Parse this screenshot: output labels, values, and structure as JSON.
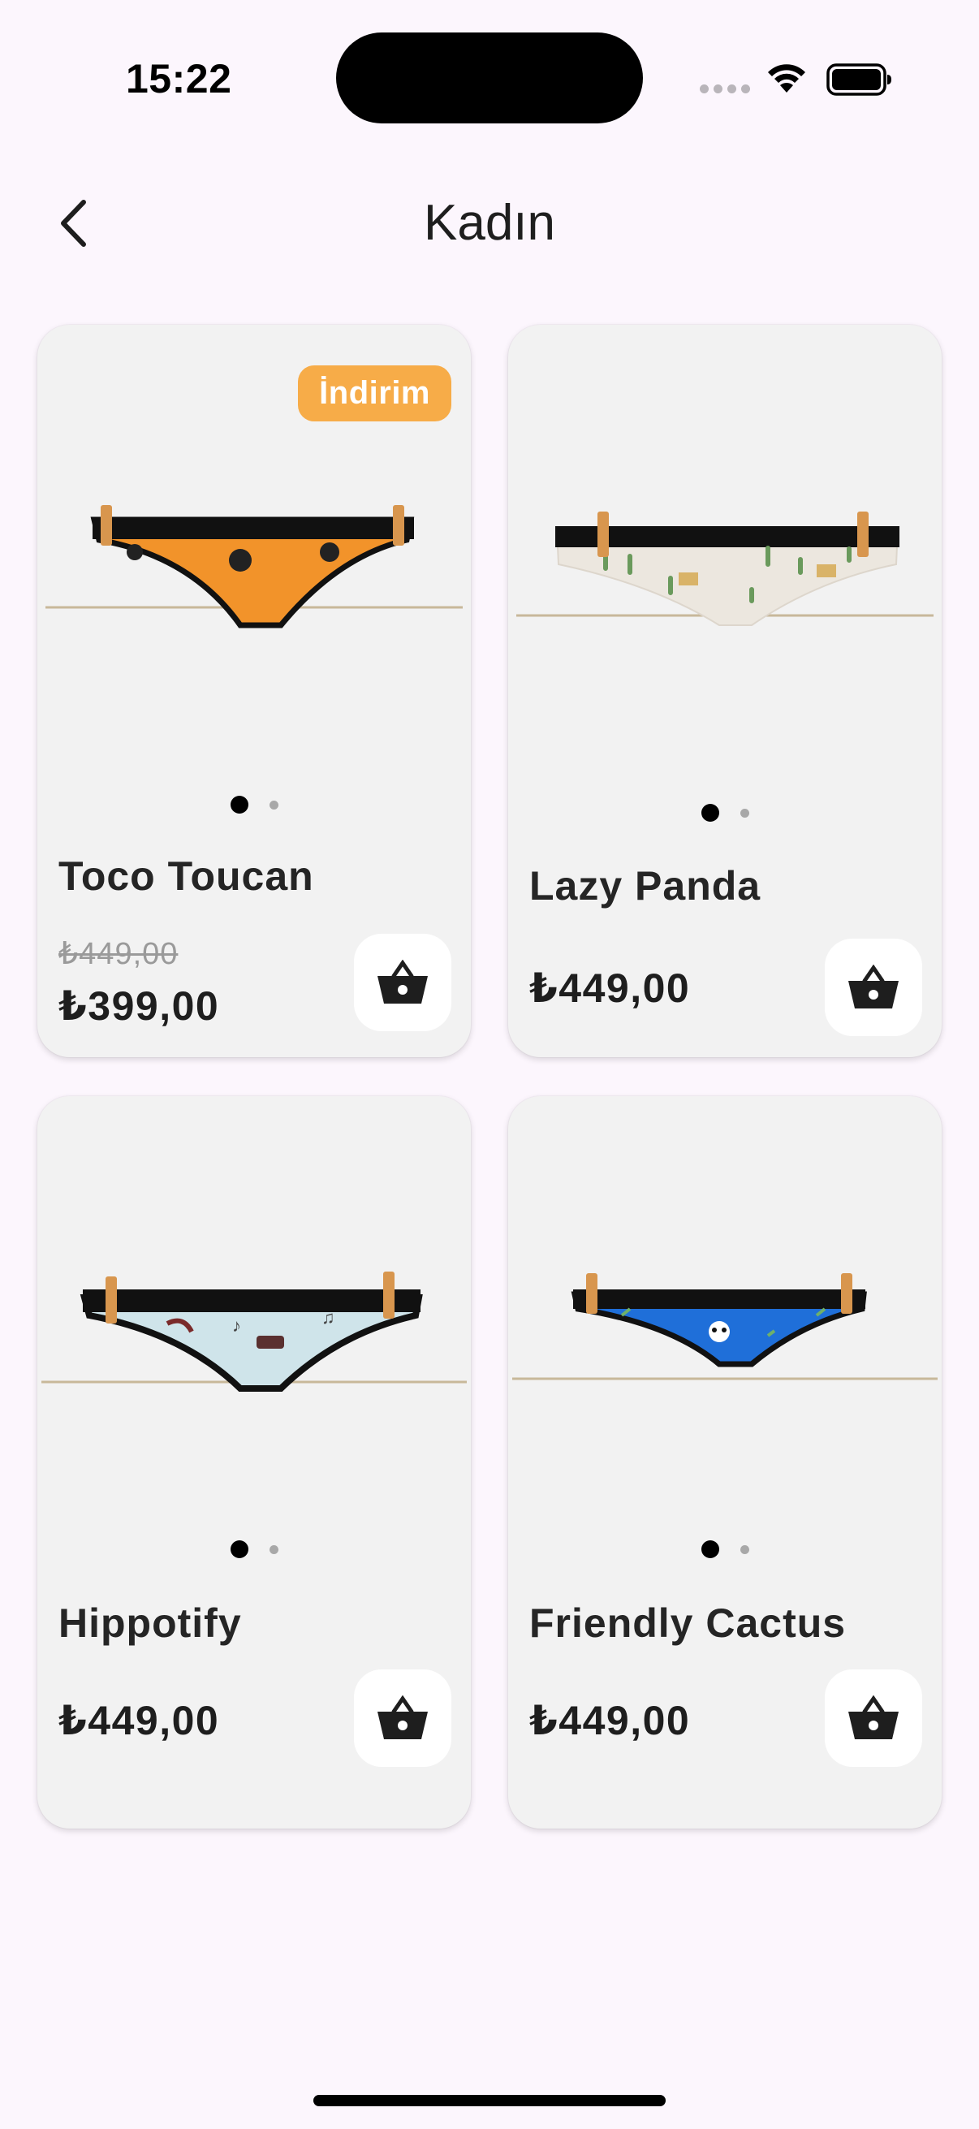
{
  "status_bar": {
    "time": "15:22"
  },
  "header": {
    "title": "Kadın"
  },
  "products": [
    {
      "name": "Toco Toucan",
      "badge": "İndirim",
      "old_price": "₺449,00",
      "price": "₺399,00",
      "image_count": 2,
      "active_image": 1,
      "color": "#f2932a",
      "icon": "toucan-print-underwear"
    },
    {
      "name": "Lazy Panda",
      "price": "₺449,00",
      "image_count": 2,
      "active_image": 1,
      "color": "#ece7df",
      "icon": "cactus-print-underwear"
    },
    {
      "name": "Hippotify",
      "price": "₺449,00",
      "image_count": 2,
      "active_image": 1,
      "color": "#cfe4ea",
      "icon": "music-print-underwear"
    },
    {
      "name": "Friendly Cactus",
      "price": "₺449,00",
      "image_count": 2,
      "active_image": 1,
      "color": "#1f6fd9",
      "icon": "panda-print-underwear"
    }
  ],
  "colors": {
    "background": "#fcf6fd",
    "card": "#f2f2f2",
    "badge": "#f7ac48"
  }
}
